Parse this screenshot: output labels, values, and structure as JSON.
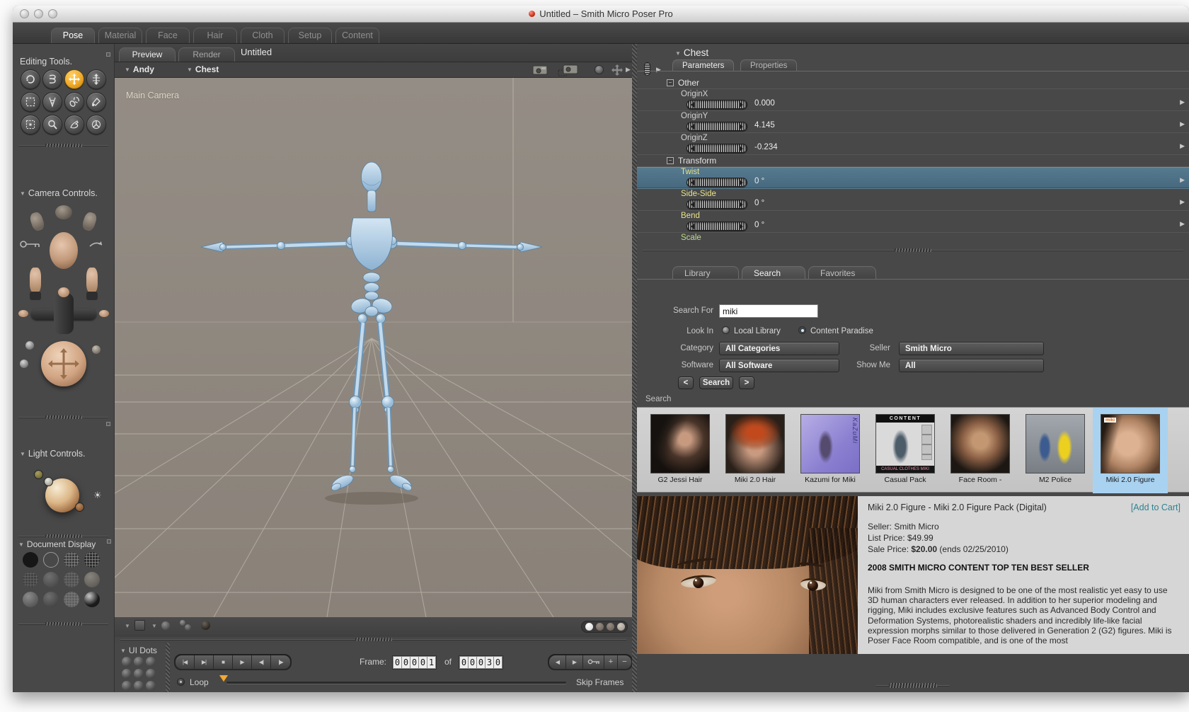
{
  "window": {
    "title": "Untitled – Smith Micro Poser Pro"
  },
  "icons": {
    "tri_down": "▼",
    "tri_right": "▶",
    "sun": "☀",
    "group_minus": "−"
  },
  "main_tabs": {
    "items": [
      "Pose",
      "Material",
      "Face",
      "Hair",
      "Cloth",
      "Setup",
      "Content"
    ]
  },
  "left_panel": {
    "editing_tools_title": "Editing Tools.",
    "camera_controls_title": "Camera Controls.",
    "light_controls_title": "Light Controls.",
    "document_display_title": "Document Display"
  },
  "document": {
    "tab_preview": "Preview",
    "tab_render": "Render",
    "title": "Untitled",
    "actor_menu_1": "Andy",
    "actor_menu_2": "Chest",
    "camera_label": "Main Camera"
  },
  "timeline": {
    "ui_dots_label": "UI Dots",
    "transport": [
      "|◀",
      "▶|",
      "■",
      "▶",
      "◀|",
      "|▶"
    ],
    "frame_label": "Frame:",
    "frame_current": [
      "0",
      "0",
      "0",
      "0",
      "1"
    ],
    "of_label": "of",
    "frame_total": [
      "0",
      "0",
      "0",
      "3",
      "0"
    ],
    "nav_left": "◀",
    "nav_right": "▶",
    "add_label": "+",
    "remove_label": "−",
    "loop_label": "Loop",
    "skip_frames_label": "Skip Frames"
  },
  "parameters": {
    "actor": "Chest",
    "tab_parameters": "Parameters",
    "tab_properties": "Properties",
    "group_other": "Other",
    "group_transform": "Transform",
    "rows": [
      {
        "label": "OriginX",
        "value": "0.000"
      },
      {
        "label": "OriginY",
        "value": "4.145"
      },
      {
        "label": "OriginZ",
        "value": "-0.234"
      },
      {
        "label": "Twist",
        "value": "0 °"
      },
      {
        "label": "Side-Side",
        "value": "0 °"
      },
      {
        "label": "Bend",
        "value": "0 °"
      },
      {
        "label": "Scale",
        "value": ""
      }
    ]
  },
  "library": {
    "tab_library": "Library",
    "tab_search": "Search",
    "tab_favorites": "Favorites",
    "search_for_label": "Search For",
    "search_value": "miki",
    "look_in_label": "Look In",
    "radio_local": "Local Library",
    "radio_paradise": "Content Paradise",
    "category_label": "Category",
    "category_value": "All Categories",
    "seller_label": "Seller",
    "seller_value": "Smith Micro",
    "software_label": "Software",
    "software_value": "All Software",
    "show_me_label": "Show Me",
    "show_me_value": "All",
    "prev_label": "<",
    "search_btn_label": "Search",
    "next_label": ">",
    "results_label": "Search"
  },
  "results": {
    "items": [
      {
        "label": "G2 Jessi Hair"
      },
      {
        "label": "Miki 2.0 Hair"
      },
      {
        "label": "Kazumi for Miki",
        "art_text": "KaZuMi"
      },
      {
        "label": "Casual Pack",
        "art_top": "CONTENT",
        "art_bottom": "CASUAL CLOTHES MIKI"
      },
      {
        "label": "Face Room -"
      },
      {
        "label": "M2 Police"
      },
      {
        "label": "Miki 2.0 Figure",
        "art_badge": "miki"
      }
    ]
  },
  "product": {
    "title": "Miki 2.0 Figure - Miki 2.0 Figure Pack (Digital)",
    "add_to_cart": "[Add to Cart]",
    "seller_line": "Seller: Smith Micro",
    "list_price_line": "List Price: $49.99",
    "sale_price_label": "Sale Price:",
    "sale_price_value": "$20.00",
    "sale_ends": "(ends 02/25/2010)",
    "banner": "2008 SMITH MICRO CONTENT TOP TEN BEST SELLER",
    "description": "Miki from Smith Micro is designed to be one of the most realistic yet easy to use 3D human characters ever released. In addition to her superior modeling and rigging, Miki includes exclusive features such as Advanced Body Control and Deformation Systems, photorealistic shaders and incredibly life-like facial expression morphs similar to those delivered in Generation 2 (G2) figures. Miki is Poser Face Room compatible, and is one of the most"
  },
  "colors": {
    "accent_orange": "#efa928",
    "selection_blue": "#4c7590",
    "thumb_selection": "#a9d2f1",
    "link_teal": "#2e8391"
  }
}
